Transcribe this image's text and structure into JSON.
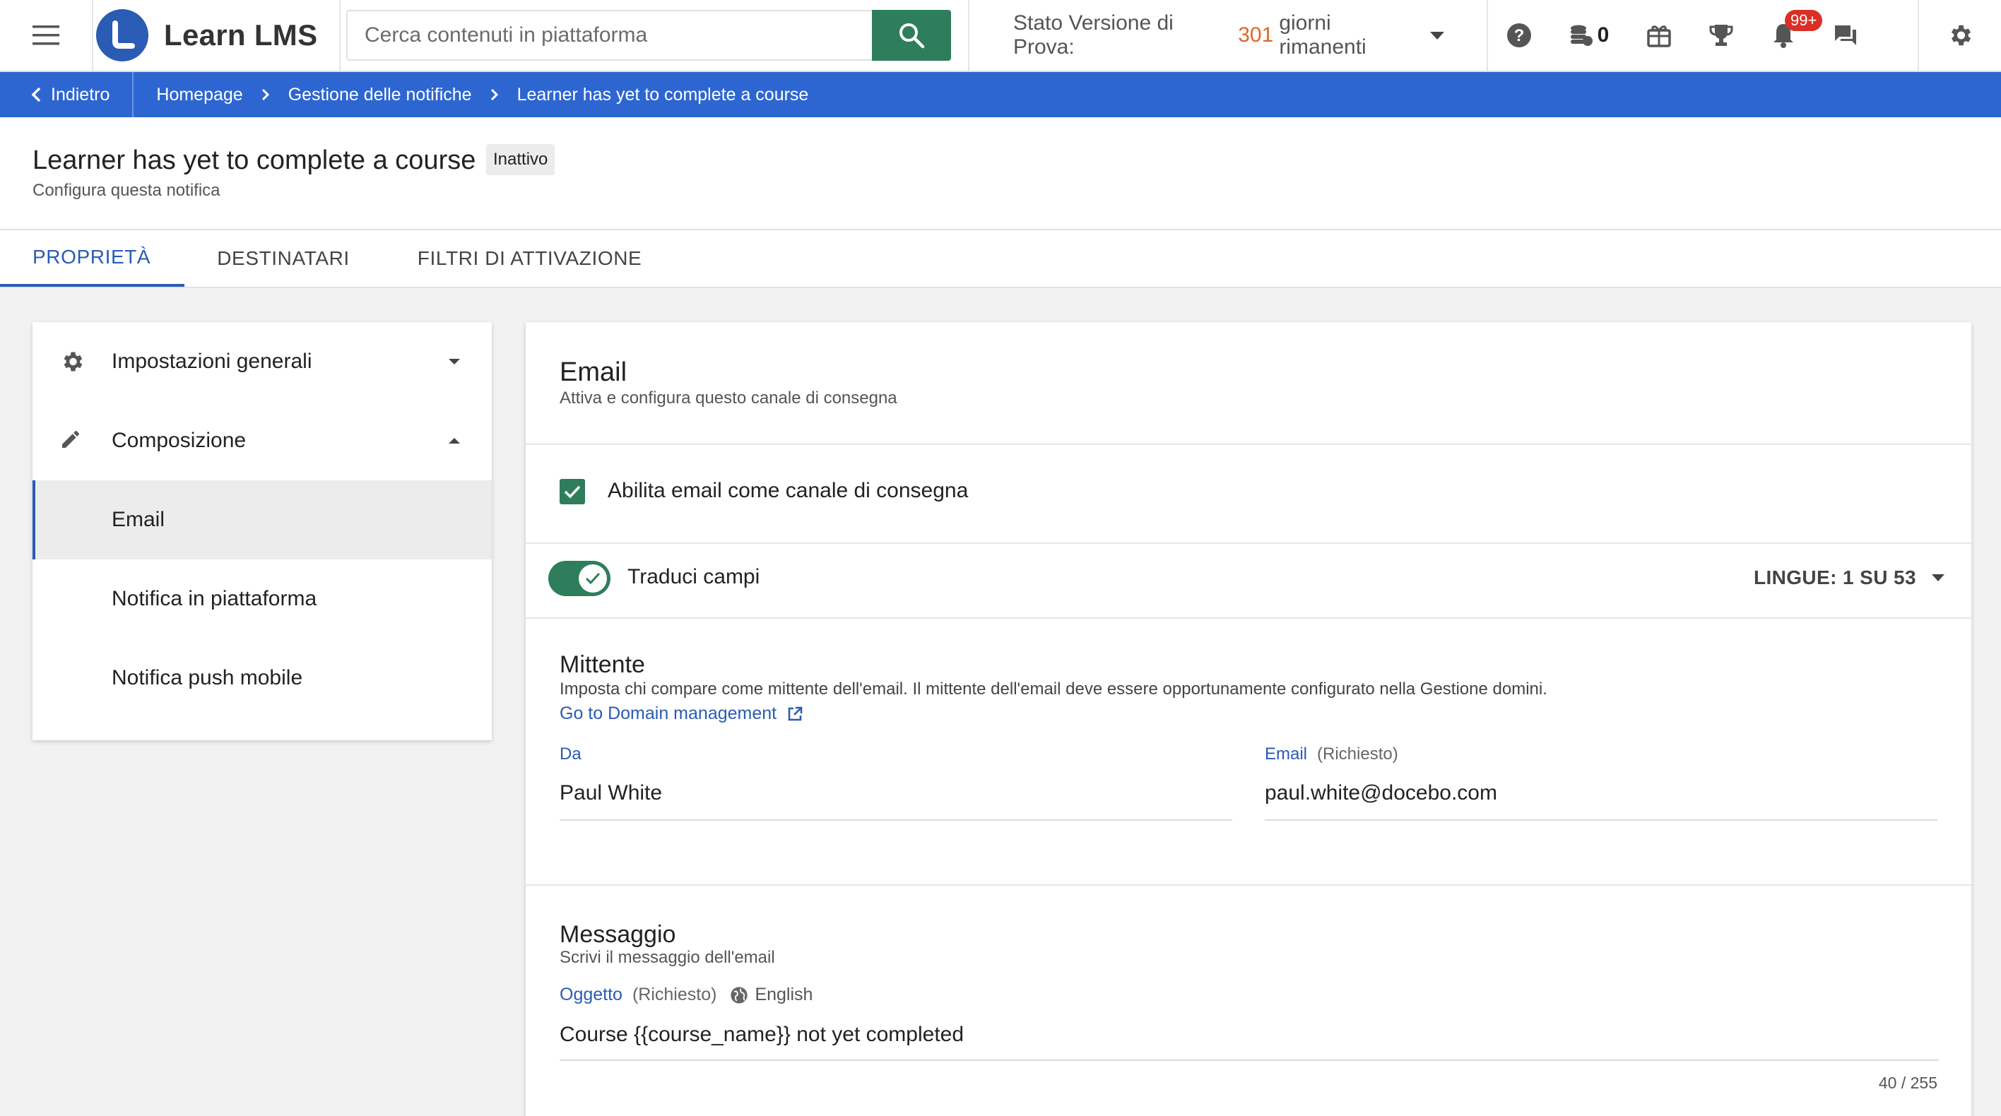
{
  "header": {
    "app_name": "Learn LMS",
    "search_placeholder": "Cerca contenuti in piattaforma",
    "trial_prefix": "Stato Versione di Prova:",
    "trial_days": "301",
    "trial_suffix": "giorni rimanenti",
    "coins_count": "0",
    "notifications_badge": "99+",
    "accent_green": "#2e7d5b",
    "brand_blue": "#2a5bb5"
  },
  "breadcrumb": {
    "back_label": "Indietro",
    "items": [
      "Homepage",
      "Gestione delle notifiche",
      "Learner has yet to complete a course"
    ]
  },
  "page": {
    "title": "Learner has yet to complete a course",
    "status": "Inattivo",
    "subtitle": "Configura questa notifica"
  },
  "tabs": [
    "PROPRIETÀ",
    "DESTINATARI",
    "FILTRI DI ATTIVAZIONE"
  ],
  "sidebar": {
    "items": [
      {
        "label": "Impostazioni generali",
        "icon": "gear-icon"
      },
      {
        "label": "Composizione",
        "icon": "pencil-icon"
      },
      {
        "label": "Email"
      },
      {
        "label": "Notifica in piattaforma"
      },
      {
        "label": "Notifica push mobile"
      }
    ]
  },
  "email": {
    "title": "Email",
    "subtitle": "Attiva e configura questo canale di consegna",
    "enable_label": "Abilita email come canale di consegna",
    "enable_checked": true,
    "translate_label": "Traduci campi",
    "translate_on": true,
    "languages_label": "LINGUE: 1 SU 53"
  },
  "sender": {
    "title": "Mittente",
    "description": "Imposta chi compare come mittente dell'email. Il mittente dell'email deve essere opportunamente configurato nella Gestione domini.",
    "link_label": "Go to Domain management",
    "from_label": "Da",
    "from_value": "Paul White",
    "email_label": "Email",
    "required_label": "(Richiesto)",
    "email_value": "paul.white@docebo.com"
  },
  "message": {
    "title": "Messaggio",
    "subtitle": "Scrivi il messaggio dell'email",
    "subject_label": "Oggetto",
    "required_label": "(Richiesto)",
    "language": "English",
    "subject_value": "Course {{course_name}} not yet completed",
    "counter": "40 / 255"
  }
}
